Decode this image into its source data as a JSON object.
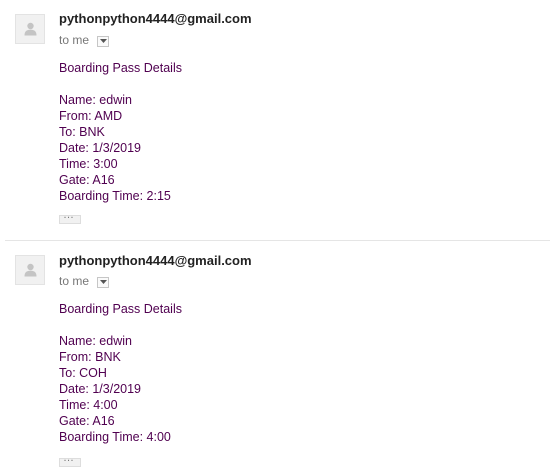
{
  "messages": [
    {
      "sender": "pythonpython4444@gmail.com",
      "recipient": "to me",
      "heading": "Boarding Pass Details",
      "details": [
        "Name: edwin",
        "From: AMD",
        "To: BNK",
        "Date: 1/3/2019",
        "Time: 3:00",
        "Gate: A16",
        "Boarding Time: 2:15"
      ],
      "avatar_icon": "person-icon",
      "dropdown_icon": "chevron-down-icon",
      "expand_label": "…"
    },
    {
      "sender": "pythonpython4444@gmail.com",
      "recipient": "to me",
      "heading": "Boarding Pass Details",
      "details": [
        "Name: edwin",
        "From: BNK",
        "To: COH",
        "Date: 1/3/2019",
        "Time: 4:00",
        "Gate: A16",
        "Boarding Time: 4:00"
      ],
      "avatar_icon": "person-icon",
      "dropdown_icon": "chevron-down-icon",
      "expand_label": "…"
    }
  ],
  "colors": {
    "body_text": "#500050",
    "sender_text": "#222222",
    "muted_text": "#777777"
  }
}
